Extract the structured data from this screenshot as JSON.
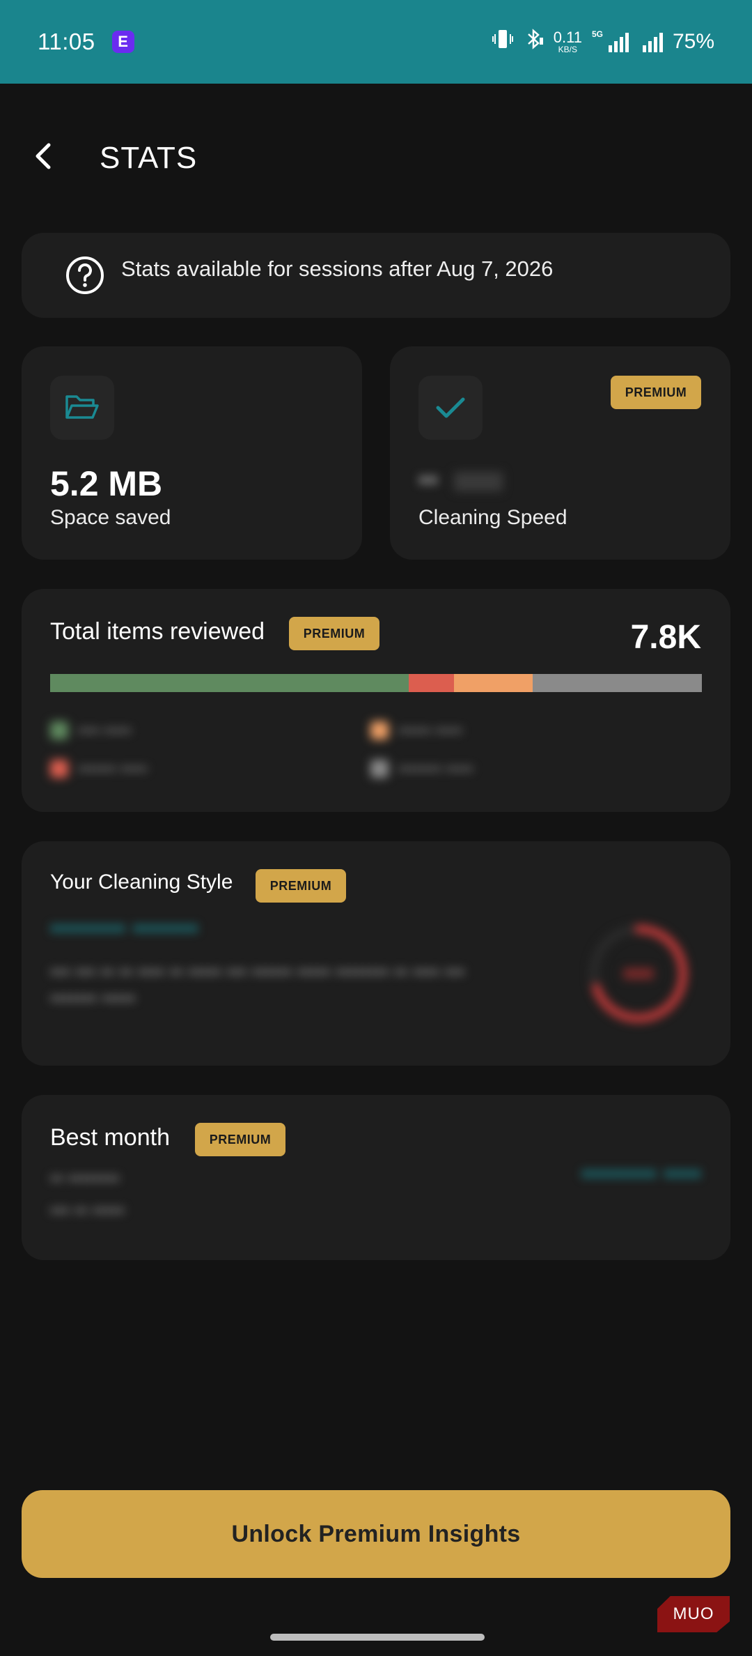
{
  "status_bar": {
    "time": "11:05",
    "app_badge_letter": "E",
    "net_speed_value": "0.11",
    "net_speed_unit": "KB/S",
    "network_type": "5G",
    "battery": "75%"
  },
  "header": {
    "title": "STATS"
  },
  "info_banner": {
    "text": "Stats available for sessions after Aug 7, 2026"
  },
  "space_saved": {
    "value": "5.2 MB",
    "label": "Space saved",
    "icon": "folder-open-icon"
  },
  "cleaning_speed": {
    "label": "Cleaning Speed",
    "badge": "PREMIUM",
    "icon": "check-icon",
    "blurred_value": "••"
  },
  "items_reviewed": {
    "title": "Total items reviewed",
    "badge": "PREMIUM",
    "total": "7.8K",
    "segments": [
      {
        "name": "kept",
        "fraction": 0.55,
        "color": "#5f8a5f"
      },
      {
        "name": "deleted",
        "fraction": 0.07,
        "color": "#dc5e4f"
      },
      {
        "name": "moved",
        "fraction": 0.12,
        "color": "#f0a066"
      },
      {
        "name": "skipped",
        "fraction": 0.26,
        "color": "#8a8a8a"
      }
    ],
    "legend": [
      {
        "label": "▪▪▪▪ ▪▪▪▪▪",
        "color": "#5f8a5f"
      },
      {
        "label": "▪▪▪▪▪▪ ▪▪▪▪▪",
        "color": "#f0a066"
      },
      {
        "label": "▪▪▪▪▪▪▪ ▪▪▪▪▪",
        "color": "#dc5e4f"
      },
      {
        "label": "▪▪▪▪▪▪▪▪ ▪▪▪▪▪",
        "color": "#8a8a8a"
      }
    ]
  },
  "cleaning_style": {
    "title": "Your Cleaning Style",
    "badge": "PREMIUM",
    "blurred_name": "▪▪▪▪▪▪▪▪ ▪▪▪▪▪▪▪",
    "blurred_desc": "▪▪▪ ▪▪▪ ▪▪ ▪▪ ▪▪▪▪ ▪▪ ▪▪▪▪▪ ▪▪▪ ▪▪▪▪▪▪ ▪▪▪▪▪ ▪▪▪▪▪▪▪▪ ▪▪ ▪▪▪▪ ▪▪▪ ▪▪▪▪▪▪▪ ▪▪▪▪▪",
    "gauge_fraction": 0.7,
    "gauge_color": "#c23a3a"
  },
  "best_month": {
    "title": "Best month",
    "badge": "PREMIUM",
    "blurred_lines": [
      "▪▪ ▪▪▪▪▪▪▪▪",
      "▪▪▪ ▪▪ ▪▪▪▪▪"
    ],
    "blurred_value": "▪▪▪▪▪▪▪▪ ▪▪▪▪"
  },
  "cta": {
    "label": "Unlock Premium Insights"
  },
  "watermark": {
    "text": "MUO"
  },
  "colors": {
    "teal": "#1a858d",
    "gold": "#d2a64a",
    "background": "#131313",
    "card": "#1e1e1e"
  }
}
